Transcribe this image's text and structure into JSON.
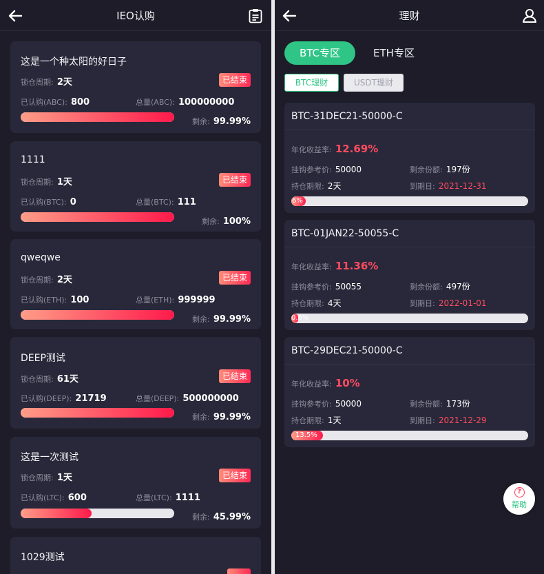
{
  "left": {
    "title": "IEO认购",
    "cards": [
      {
        "name": "这是一个种太阳的好日子",
        "status": "已结束",
        "lock_label": "锁仓周期:",
        "lock_value": "2天",
        "bought_label": "已认购(ABC):",
        "bought_value": "800",
        "total_label": "总量(ABC):",
        "total_value": "100000000",
        "remain_label": "剩余:",
        "remain_value": "99.99%",
        "progress": 1.0
      },
      {
        "name": "1111",
        "status": "已结束",
        "lock_label": "锁仓周期:",
        "lock_value": "1天",
        "bought_label": "已认购(BTC):",
        "bought_value": "0",
        "total_label": "总量(BTC):",
        "total_value": "111",
        "remain_label": "剩余:",
        "remain_value": "100%",
        "progress": 1.0
      },
      {
        "name": "qweqwe",
        "status": "已结束",
        "lock_label": "锁仓周期:",
        "lock_value": "2天",
        "bought_label": "已认购(ETH):",
        "bought_value": "100",
        "total_label": "总量(ETH):",
        "total_value": "999999",
        "remain_label": "剩余:",
        "remain_value": "99.99%",
        "progress": 1.0
      },
      {
        "name": "DEEP测试",
        "status": "已结束",
        "lock_label": "锁仓周期:",
        "lock_value": "61天",
        "bought_label": "已认购(DEEP):",
        "bought_value": "21719",
        "total_label": "总量(DEEP):",
        "total_value": "500000000",
        "remain_label": "剩余:",
        "remain_value": "99.99%",
        "progress": 1.0
      },
      {
        "name": "这是一次测试",
        "status": "已结束",
        "lock_label": "锁仓周期:",
        "lock_value": "1天",
        "bought_label": "已认购(LTC):",
        "bought_value": "600",
        "total_label": "总量(LTC):",
        "total_value": "1111",
        "remain_label": "剩余:",
        "remain_value": "45.99%",
        "progress": 0.46
      },
      {
        "name": "1029测试"
      }
    ]
  },
  "right": {
    "title": "理财",
    "tabs": {
      "active": "BTC专区",
      "inactive": "ETH专区"
    },
    "chips": {
      "active": "BTC理财",
      "inactive": "USDT理财"
    },
    "products": [
      {
        "name": "BTC-31DEC21-50000-C",
        "yield_label": "年化收益率:",
        "yield_value": "12.69%",
        "ref_label": "挂钩参考价:",
        "ref_value": "50000",
        "share_label": "剩余份额:",
        "share_value": "197份",
        "hold_label": "持仓期限:",
        "hold_value": "2天",
        "exp_label": "到期日:",
        "exp_value": "2021-12-31",
        "progress_text": "6%",
        "progress": 0.06
      },
      {
        "name": "BTC-01JAN22-50055-C",
        "yield_label": "年化收益率:",
        "yield_value": "11.36%",
        "ref_label": "挂钩参考价:",
        "ref_value": "50055",
        "share_label": "剩余份额:",
        "share_value": "497份",
        "hold_label": "持仓期限:",
        "hold_value": "4天",
        "exp_label": "到期日:",
        "exp_value": "2022-01-01",
        "progress_text": "0.6%",
        "progress": 0.006
      },
      {
        "name": "BTC-29DEC21-50000-C",
        "yield_label": "年化收益率:",
        "yield_value": "10%",
        "ref_label": "挂钩参考价:",
        "ref_value": "50000",
        "share_label": "剩余份额:",
        "share_value": "173份",
        "hold_label": "持仓期限:",
        "hold_value": "1天",
        "exp_label": "到期日:",
        "exp_value": "2021-12-29",
        "progress_text": "13.5%",
        "progress": 0.135
      }
    ],
    "help_label": "帮助"
  },
  "colors": {
    "accent": "#2fc586",
    "danger": "#ff4b5f",
    "background": "#1d1c28",
    "card": "#28283a"
  },
  "icons": {
    "back": "arrow-left-icon",
    "records": "clipboard-icon",
    "user": "user-icon",
    "help": "question-circle-icon"
  }
}
